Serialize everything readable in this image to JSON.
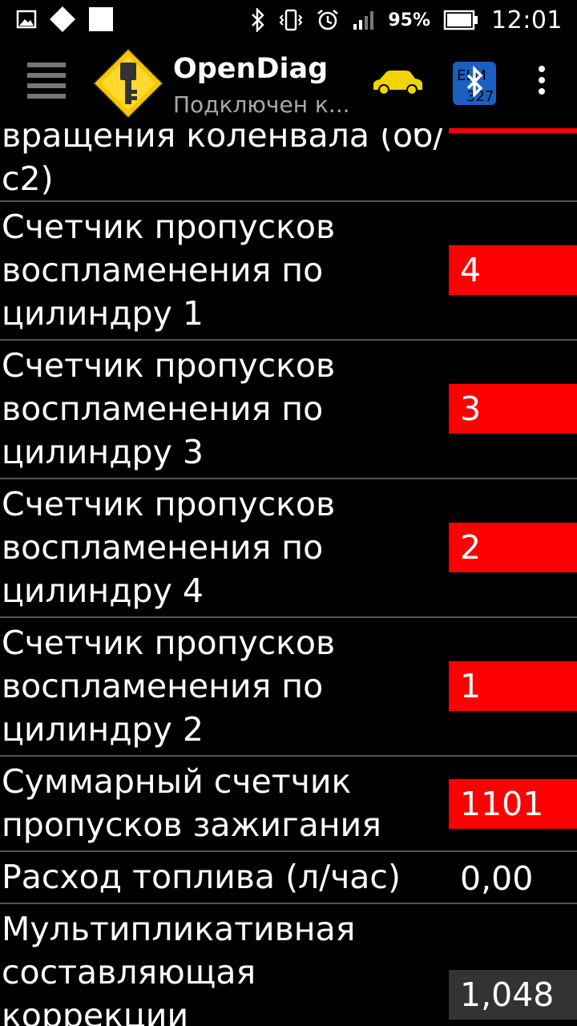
{
  "status_bar": {
    "battery_percent": "95%",
    "time": "12:01",
    "left_icons": [
      "image-icon",
      "diamond-icon",
      "square-icon"
    ],
    "right_icons": [
      "bluetooth-icon",
      "vibrate-icon",
      "alarm-icon",
      "signal-icon",
      "battery-icon"
    ]
  },
  "app_bar": {
    "title": "OpenDiag",
    "subtitle": "Подключен к...",
    "icons": [
      "menu-icon",
      "app-logo-icon",
      "car-icon",
      "bluetooth-elm-icon",
      "more-options-icon"
    ]
  },
  "colors": {
    "alert": "#ff0000",
    "normal_value_bg": "#333333",
    "background": "#000000",
    "divider": "#555555",
    "subtitle": "#a9a9a9",
    "car": "#f2d500"
  },
  "rows": [
    {
      "label_line1": "вращения коленвала (об/",
      "label_line2": "с2)",
      "value": "",
      "state": "alert"
    },
    {
      "label": "Счетчик пропусков воспламенения по цилиндру 1",
      "value": "4",
      "state": "alert"
    },
    {
      "label": "Счетчик пропусков воспламенения по цилиндру 3",
      "value": "3",
      "state": "alert"
    },
    {
      "label": "Счетчик пропусков воспламенения по цилиндру 4",
      "value": "2",
      "state": "alert"
    },
    {
      "label": "Счетчик пропусков воспламенения по цилиндру 2",
      "value": "1",
      "state": "alert"
    },
    {
      "label": "Суммарный счетчик пропусков зажигания",
      "value": "1101",
      "state": "alert"
    },
    {
      "label": "Расход топлива (л/час)",
      "value": "0,00",
      "state": "normal"
    },
    {
      "label": "Мультипликативная составляющая коррекции",
      "value": "1,048",
      "state": "normal"
    }
  ]
}
